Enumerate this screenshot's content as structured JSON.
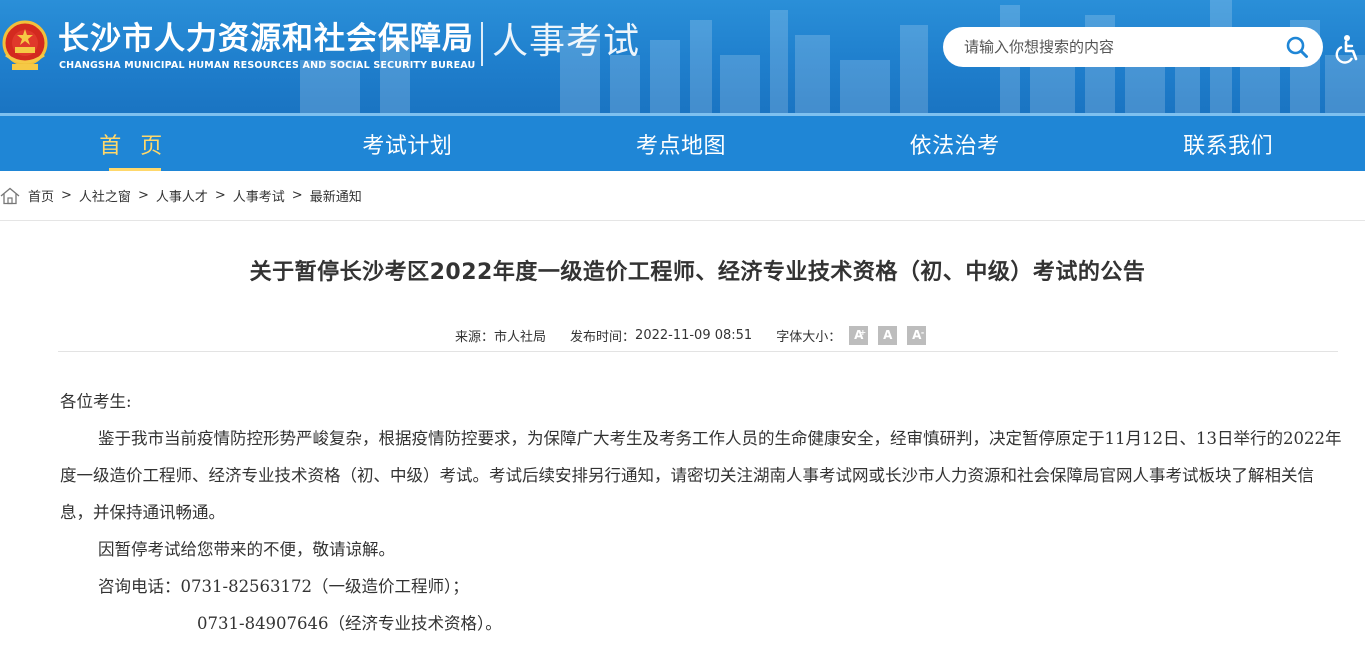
{
  "header": {
    "title": "长沙市人力资源和社会保障局",
    "subtitle": "CHANGSHA MUNICIPAL HUMAN RESOURCES AND SOCIAL SECURITY BUREAU",
    "section": "人事考试",
    "search_placeholder": "请输入你想搜索的内容",
    "search_icon": "search-icon",
    "accessibility_icon": "accessibility-icon"
  },
  "nav": {
    "items": [
      {
        "label": "首 页",
        "active": true
      },
      {
        "label": "考试计划",
        "active": false
      },
      {
        "label": "考点地图",
        "active": false
      },
      {
        "label": "依法治考",
        "active": false
      },
      {
        "label": "联系我们",
        "active": false
      }
    ]
  },
  "breadcrumb": {
    "icon": "home-icon",
    "items": [
      "首页",
      "人社之窗",
      "人事人才",
      "人事考试",
      "最新通知"
    ],
    "separator": ">"
  },
  "article": {
    "title": "关于暂停长沙考区2022年度一级造价工程师、经济专业技术资格（初、中级）考试的公告",
    "source_label": "来源：",
    "source": "市人社局",
    "date_label": "发布时间：",
    "date": "2022-11-09 08:51",
    "font_size_label": "字体大小：",
    "font_buttons": [
      "A",
      "A",
      "A"
    ],
    "greeting": "各位考生:",
    "paragraph1": "鉴于我市当前疫情防控形势严峻复杂，根据疫情防控要求，为保障广大考生及考务工作人员的生命健康安全，经审慎研判，决定暂停原定于11月12日、13日举行的2022年度一级造价工程师、经济专业技术资格（初、中级）考试。考试后续安排另行通知，请密切关注湖南人事考试网或长沙市人力资源和社会保障局官网人事考试板块了解相关信息，并保持通讯畅通。",
    "paragraph2": "因暂停考试给您带来的不便，敬请谅解。",
    "phone1": "咨询电话：0731-82563172（一级造价工程师）；",
    "phone2": "0731-84907646（经济专业技术资格）。"
  },
  "colors": {
    "header_blue": "#1f7fcd",
    "nav_blue": "#1f86d6",
    "nav_active": "#ffd86b"
  }
}
